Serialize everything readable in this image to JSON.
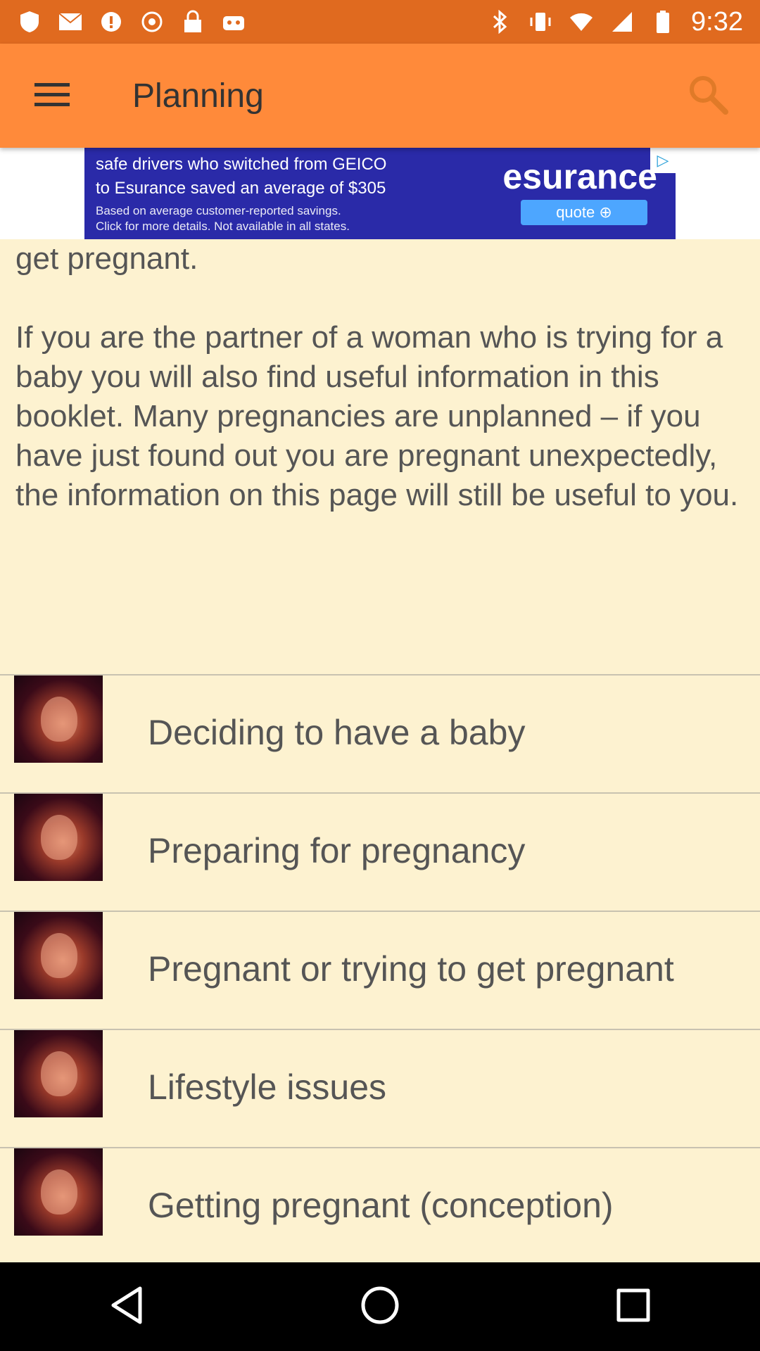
{
  "status_bar": {
    "time": "9:32",
    "left_icons": [
      "shield-icon",
      "mail-icon",
      "alert-icon",
      "fake-gps-icon",
      "lock-icon",
      "robot-icon"
    ],
    "right_icons": [
      "bluetooth-icon",
      "vibrate-icon",
      "wifi-icon",
      "signal-icon",
      "battery-icon"
    ]
  },
  "toolbar": {
    "title": "Planning",
    "background": "#ff8a3a"
  },
  "ad": {
    "line1": "safe drivers who switched from GEICO",
    "line2": "to Esurance saved an average of $305",
    "line3": "Based on average customer-reported savings.",
    "line4": "Click for more details. Not available in all states.",
    "brand": "esurance",
    "cta": "quote ⊕"
  },
  "content": {
    "intro_partial": "where you can get help if you are finding it difficult to get pregnant.",
    "intro_paragraph": "If you are the partner of a woman who is trying for a baby you will also find useful information in this booklet. Many pregnancies are unplanned – if you have just found out you are pregnant unexpectedly, the information on this page will still be useful to you.",
    "items": [
      {
        "label": "Deciding to have a baby"
      },
      {
        "label": "Preparing for pregnancy"
      },
      {
        "label": "Pregnant or trying to get pregnant"
      },
      {
        "label": "Lifestyle issues"
      },
      {
        "label": "Getting pregnant (conception)"
      }
    ]
  },
  "colors": {
    "status_bar": "#e06a1f",
    "content_bg": "#fdf2d0",
    "ad_bg": "#2a2aa8"
  }
}
